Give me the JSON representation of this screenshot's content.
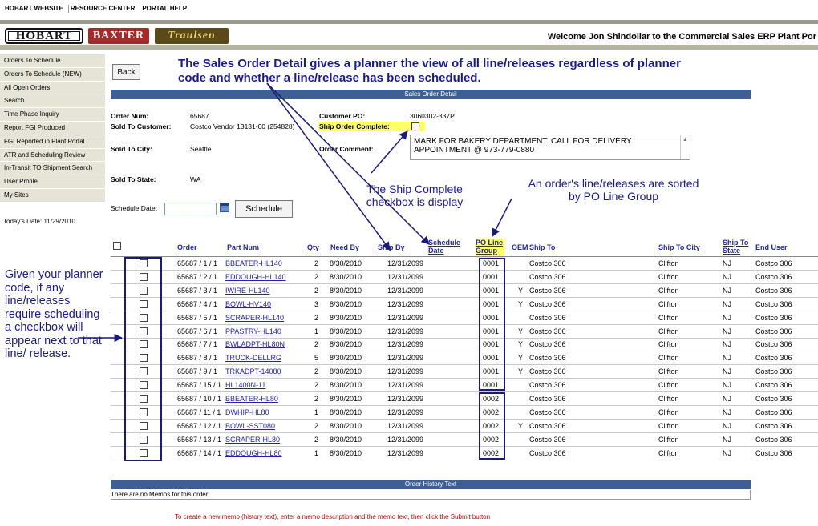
{
  "toplinks": [
    "HOBART WEBSITE",
    "RESOURCE CENTER",
    "PORTAL HELP"
  ],
  "header": {
    "logos": [
      "HOBART",
      "BAXTER",
      "Traulsen"
    ],
    "welcome": "Welcome Jon Shindollar to the Commercial Sales ERP Plant Por"
  },
  "sidebar": {
    "items": [
      "Orders To Schedule",
      "Orders To Schedule (NEW)",
      "All Open Orders",
      "Search",
      "Time Phase Inquiry",
      "Report FGI Produced",
      "FGI Reported in Plant Portal",
      "ATR and Scheduling Review",
      "In-Transit TO Shipment Search",
      "User Profile",
      "My Sites"
    ],
    "today": "Today's Date: 11/29/2010"
  },
  "main": {
    "back_label": "Back",
    "section_title": "Sales Order Detail",
    "order": {
      "order_num_label": "Order Num:",
      "order_num": "65687",
      "sold_to_label": "Sold To Customer:",
      "sold_to": "Costco Vendor 13131-00 (254828)",
      "city_label": "Sold To City:",
      "city": "Seattle",
      "state_label": "Sold To State:",
      "state": "WA",
      "po_label": "Customer PO:",
      "po": "3060302-337P",
      "ship_complete_label": "Ship Order Complete:",
      "comment_label": "Order Comment:",
      "comment": "MARK FOR BAKERY DEPARTMENT.  CALL FOR DELIVERY APPOINTMENT @ 973-779-0880"
    },
    "schedule_date_label": "Schedule Date:",
    "schedule_button": "Schedule",
    "history_title": "Order History Text",
    "no_memos": "There are no Memos for this order.",
    "memo_instructions": "To create a new memo (history text), enter a memo description and the memo text, then click the Submit button"
  },
  "annotations": {
    "top": "The Sales Order Detail gives a planner the view of all line/releases regardless of planner code and whether a line/release has been scheduled.",
    "ship_complete": "The Ship Complete checkbox is display",
    "sorted": "An order's line/releases are sorted by PO Line Group",
    "left": "Given your planner code, if any line/releases require scheduling a checkbox will appear next to that line/ release."
  },
  "table": {
    "headers": {
      "order": "Order",
      "part": "Part Num",
      "qty": "Qty",
      "need_by": "Need By",
      "ship_by": "Ship By",
      "sched_date": "Schedule Date",
      "po_line_group": "PO Line Group",
      "oem": "OEM",
      "ship_to": "Ship To",
      "ship_city": "Ship To City",
      "ship_state": "Ship To State",
      "end_user": "End User"
    },
    "rows": [
      {
        "order": "65687 / 1 / 1",
        "part": "BBEATER-HL140",
        "qty": "2",
        "need_by": "8/30/2010",
        "ship_by": "12/31/2099",
        "group": "0001",
        "oem": "",
        "ship_to": "Costco 306",
        "city": "Clifton",
        "state": "NJ",
        "end_user": "Costco 306"
      },
      {
        "order": "65687 / 2 / 1",
        "part": "EDDOUGH-HL140",
        "qty": "2",
        "need_by": "8/30/2010",
        "ship_by": "12/31/2099",
        "group": "0001",
        "oem": "",
        "ship_to": "Costco 306",
        "city": "Clifton",
        "state": "NJ",
        "end_user": "Costco 306"
      },
      {
        "order": "65687 / 3 / 1",
        "part": "IWIRE-HL140",
        "qty": "2",
        "need_by": "8/30/2010",
        "ship_by": "12/31/2099",
        "group": "0001",
        "oem": "Y",
        "ship_to": "Costco 306",
        "city": "Clifton",
        "state": "NJ",
        "end_user": "Costco 306"
      },
      {
        "order": "65687 / 4 / 1",
        "part": "BOWL-HV140",
        "qty": "3",
        "need_by": "8/30/2010",
        "ship_by": "12/31/2099",
        "group": "0001",
        "oem": "Y",
        "ship_to": "Costco 306",
        "city": "Clifton",
        "state": "NJ",
        "end_user": "Costco 306"
      },
      {
        "order": "65687 / 5 / 1",
        "part": "SCRAPER-HL140",
        "qty": "2",
        "need_by": "8/30/2010",
        "ship_by": "12/31/2099",
        "group": "0001",
        "oem": "",
        "ship_to": "Costco 306",
        "city": "Clifton",
        "state": "NJ",
        "end_user": "Costco 306"
      },
      {
        "order": "65687 / 6 / 1",
        "part": "PPASTRY-HL140",
        "qty": "1",
        "need_by": "8/30/2010",
        "ship_by": "12/31/2099",
        "group": "0001",
        "oem": "Y",
        "ship_to": "Costco 306",
        "city": "Clifton",
        "state": "NJ",
        "end_user": "Costco 306"
      },
      {
        "order": "65687 / 7 / 1",
        "part": "BWLADPT-HL80N",
        "qty": "2",
        "need_by": "8/30/2010",
        "ship_by": "12/31/2099",
        "group": "0001",
        "oem": "Y",
        "ship_to": "Costco 306",
        "city": "Clifton",
        "state": "NJ",
        "end_user": "Costco 306"
      },
      {
        "order": "65687 / 8 / 1",
        "part": "TRUCK-DELLRG",
        "qty": "5",
        "need_by": "8/30/2010",
        "ship_by": "12/31/2099",
        "group": "0001",
        "oem": "Y",
        "ship_to": "Costco 306",
        "city": "Clifton",
        "state": "NJ",
        "end_user": "Costco 306"
      },
      {
        "order": "65687 / 9 / 1",
        "part": "TRKADPT-14080",
        "qty": "2",
        "need_by": "8/30/2010",
        "ship_by": "12/31/2099",
        "group": "0001",
        "oem": "Y",
        "ship_to": "Costco 306",
        "city": "Clifton",
        "state": "NJ",
        "end_user": "Costco 306"
      },
      {
        "order": "65687 / 15 / 1",
        "part": "HL1400N-11",
        "qty": "2",
        "need_by": "8/30/2010",
        "ship_by": "12/31/2099",
        "group": "0001",
        "oem": "",
        "ship_to": "Costco 306",
        "city": "Clifton",
        "state": "NJ",
        "end_user": "Costco 306"
      },
      {
        "order": "65687 / 10 / 1",
        "part": "BBEATER-HL80",
        "qty": "2",
        "need_by": "8/30/2010",
        "ship_by": "12/31/2099",
        "group": "0002",
        "oem": "",
        "ship_to": "Costco 306",
        "city": "Clifton",
        "state": "NJ",
        "end_user": "Costco 306"
      },
      {
        "order": "65687 / 11 / 1",
        "part": "DWHIP-HL80",
        "qty": "1",
        "need_by": "8/30/2010",
        "ship_by": "12/31/2099",
        "group": "0002",
        "oem": "",
        "ship_to": "Costco 306",
        "city": "Clifton",
        "state": "NJ",
        "end_user": "Costco 306"
      },
      {
        "order": "65687 / 12 / 1",
        "part": "BOWL-SST080",
        "qty": "2",
        "need_by": "8/30/2010",
        "ship_by": "12/31/2099",
        "group": "0002",
        "oem": "Y",
        "ship_to": "Costco 306",
        "city": "Clifton",
        "state": "NJ",
        "end_user": "Costco 306"
      },
      {
        "order": "65687 / 13 / 1",
        "part": "SCRAPER-HL80",
        "qty": "2",
        "need_by": "8/30/2010",
        "ship_by": "12/31/2099",
        "group": "0002",
        "oem": "",
        "ship_to": "Costco 306",
        "city": "Clifton",
        "state": "NJ",
        "end_user": "Costco 306"
      },
      {
        "order": "65687 / 14 / 1",
        "part": "EDDOUGH-HL80",
        "qty": "1",
        "need_by": "8/30/2010",
        "ship_by": "12/31/2099",
        "group": "0002",
        "oem": "",
        "ship_to": "Costco 306",
        "city": "Clifton",
        "state": "NJ",
        "end_user": "Costco 306"
      }
    ]
  },
  "colors": {
    "titlebar": "#3e5f96",
    "sidebar": "#e6e4d6",
    "annotation": "#1a1a8c",
    "highlight": "#ffff66",
    "link": "#2222aa",
    "memo_text": "#cc0000"
  }
}
